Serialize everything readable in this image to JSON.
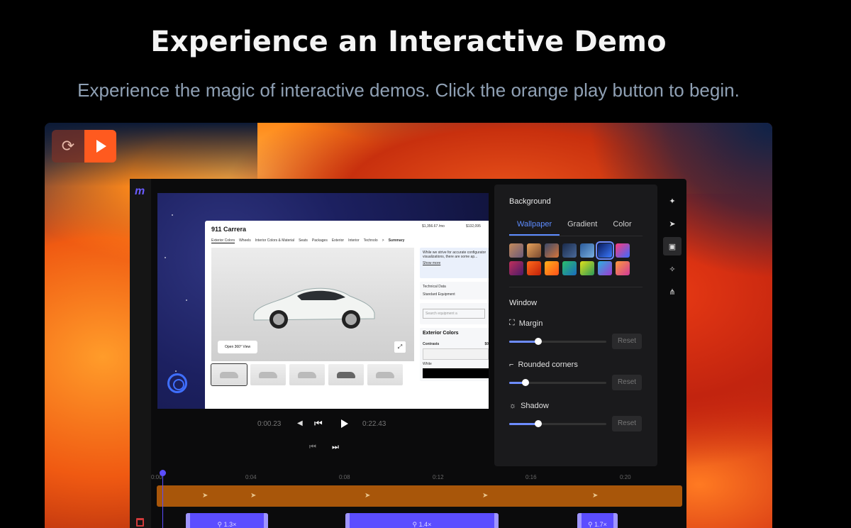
{
  "hero": {
    "title": "Experience an Interactive Demo",
    "subtitle": "Experience the magic of interactive demos. Click the orange play button to begin."
  },
  "player": {
    "restart_icon": "restart-icon",
    "play_icon": "play-icon",
    "accent": "#ff5a1f"
  },
  "app": {
    "logo": "m",
    "preview": {
      "site_title": "911 Carrera",
      "price_1": "$1,356.67 /mo",
      "price_2": "$132,095",
      "tabs": [
        "Exterior Colors",
        "Wheels",
        "Interior Colors & Material",
        "Seats",
        "Packages",
        "Exterior",
        "Interior",
        "Technolo",
        ">",
        "Summary"
      ],
      "open_360": "Open 360° View",
      "note": "While we strive for accurate configurator visualizations, there are some ap...",
      "note_link": "Show more",
      "tech_data": "Technical Data",
      "std_equip": "Standard Equipment",
      "search_placeholder": "Search equipment a",
      "colors_title": "Exterior Colors",
      "contrasts": "Contrasts",
      "contrasts_price": "$0",
      "white": "White",
      "black": "Black"
    },
    "transport": {
      "current_time": "0:00.23",
      "total_time": "0:22.43"
    },
    "timeline": {
      "ticks": [
        "0:00",
        "0:04",
        "0:08",
        "0:12",
        "0:16",
        "0:20"
      ],
      "zooms": [
        "1.3×",
        "1.4×",
        "1.7×"
      ]
    },
    "settings": {
      "background_heading": "Background",
      "tabs": [
        "Wallpaper",
        "Gradient",
        "Color"
      ],
      "active_tab": "Wallpaper",
      "window_heading": "Window",
      "margin_label": "Margin",
      "margin_value": 0.3,
      "corners_label": "Rounded corners",
      "corners_value": 0.17,
      "shadow_label": "Shadow",
      "shadow_value": 0.3,
      "reset_label": "Reset"
    },
    "tools": [
      "sparkles-icon",
      "cursor-arrow-icon",
      "image-icon",
      "magic-wand-icon",
      "share-icon"
    ]
  }
}
